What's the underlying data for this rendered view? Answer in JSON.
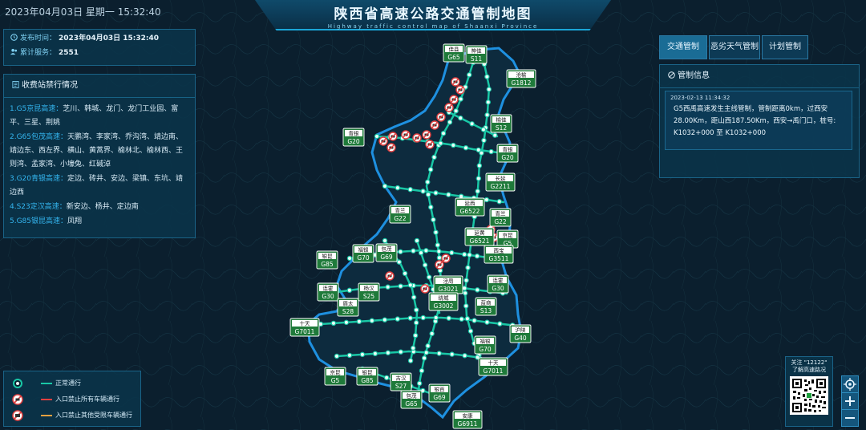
{
  "topbar": {
    "datetime": "2023年04月03日 星期一  15:32:40"
  },
  "header": {
    "title": "陕西省高速公路交通管制地图",
    "subtitle": "Highway traffic control map of Shaanxi Province"
  },
  "info": {
    "publish_label": "发布时间：",
    "publish_value": "2023年04月03日 15:32:40",
    "service_label": "累计服务：",
    "service_value": "2551"
  },
  "toll": {
    "title": "收费站禁行情况",
    "items": [
      {
        "hw": "1.G5京昆高速：",
        "text": "芝川、韩城、龙门、龙门工业园、富平、三星、荆姚"
      },
      {
        "hw": "2.G65包茂高速：",
        "text": "天鹏湾、李家湾、乔沟湾、靖边南、靖边东、西左界、横山、黄蒿界、榆林北、榆林西、王则湾、孟家湾、小壕兔、红碱淖"
      },
      {
        "hw": "3.G20青银高速：",
        "text": "定边、砖井、安边、梁镇、东坑、靖边西"
      },
      {
        "hw": "4.S23定汉高速：",
        "text": "新安边、杨井、定边南"
      },
      {
        "hw": "5.G85银昆高速：",
        "text": "凤翔"
      }
    ]
  },
  "tabs": [
    {
      "label": "交通管制",
      "active": true
    },
    {
      "label": "恶劣天气管制",
      "active": false
    },
    {
      "label": "计划管制",
      "active": false
    }
  ],
  "control": {
    "title": "管制信息",
    "time": "2023-02-13 11:34:32",
    "lines": [
      "G5西禹高速发生主线管制，管制距离0km，过西安",
      "28.00Km，距山西187.50Km，西安→禹门口，桩号:",
      "K1032+000 至 K1032+000"
    ]
  },
  "legend": [
    {
      "label": "正常通行",
      "color": "#19c7a6"
    },
    {
      "label": "入口禁止所有车辆通行",
      "color": "#e04040"
    },
    {
      "label": "入口禁止其他受限车辆通行",
      "color": "#e8a040"
    }
  ],
  "qr": {
    "line1": "关注 \"12122\"",
    "line2": "了解高速路况"
  },
  "colors": {
    "accent": "#1aa6d8",
    "road": "#19c7a6",
    "boundary": "#1e90e0",
    "sign": "#1f7a3a"
  },
  "map_labels": [
    {
      "name": "mizhi",
      "city": "佳县",
      "hw": "G65"
    },
    {
      "name": "shenmu",
      "city": "神佳",
      "hw": "S11"
    },
    {
      "name": "yulin",
      "city": "沧榆",
      "hw": "G1812"
    },
    {
      "name": "qingyin",
      "city": "青银",
      "hw": "G20"
    },
    {
      "name": "yuyu",
      "city": "榆佳",
      "hw": "S12"
    },
    {
      "name": "qingyin2",
      "city": "青银",
      "hw": "G20"
    },
    {
      "name": "changyan",
      "city": "长延",
      "hw": "G2211"
    },
    {
      "name": "qinglan",
      "city": "青兰",
      "hw": "G22"
    },
    {
      "name": "xiyan",
      "city": "延西",
      "hw": "G6522"
    },
    {
      "name": "qinglan2",
      "city": "青兰",
      "hw": "G22"
    },
    {
      "name": "jingkun",
      "city": "京昆",
      "hw": "G5"
    },
    {
      "name": "yanhuang",
      "city": "延黄",
      "hw": "G6521"
    },
    {
      "name": "yinkun",
      "city": "银昆",
      "hw": "G85"
    },
    {
      "name": "fuyin",
      "city": "福银",
      "hw": "G70"
    },
    {
      "name": "baoxi",
      "city": "包茂",
      "hw": "G69"
    },
    {
      "name": "xibao",
      "city": "西宝",
      "hw": "G3511"
    },
    {
      "name": "lianhuo",
      "city": "连霍",
      "hw": "G30"
    },
    {
      "name": "jingzhou",
      "city": "泾周",
      "hw": "G3021"
    },
    {
      "name": "lianhuo2",
      "city": "连霍",
      "hw": "G30"
    },
    {
      "name": "yanghan",
      "city": "杨汉",
      "hw": "S25"
    },
    {
      "name": "mianyang",
      "city": "眉太",
      "hw": "S28"
    },
    {
      "name": "xiyu",
      "city": "绕城",
      "hw": "G3002"
    },
    {
      "name": "lanshang",
      "city": "蓝商",
      "hw": "S13"
    },
    {
      "name": "shitian",
      "city": "十天",
      "hw": "G7011"
    },
    {
      "name": "huyu",
      "city": "沪陕",
      "hw": "G40"
    },
    {
      "name": "fuyin2",
      "city": "福银",
      "hw": "G70"
    },
    {
      "name": "shitian2",
      "city": "十天",
      "hw": "G7011"
    },
    {
      "name": "jingkun2",
      "city": "京昆",
      "hw": "G5"
    },
    {
      "name": "yinkun2",
      "city": "银昆",
      "hw": "G85"
    },
    {
      "name": "guhan",
      "city": "古汉",
      "hw": "S27"
    },
    {
      "name": "baomao",
      "city": "包茂",
      "hw": "G65"
    },
    {
      "name": "yinbai",
      "city": "银百",
      "hw": "G69"
    },
    {
      "name": "ankang",
      "city": "安康",
      "hw": "G6911"
    }
  ]
}
